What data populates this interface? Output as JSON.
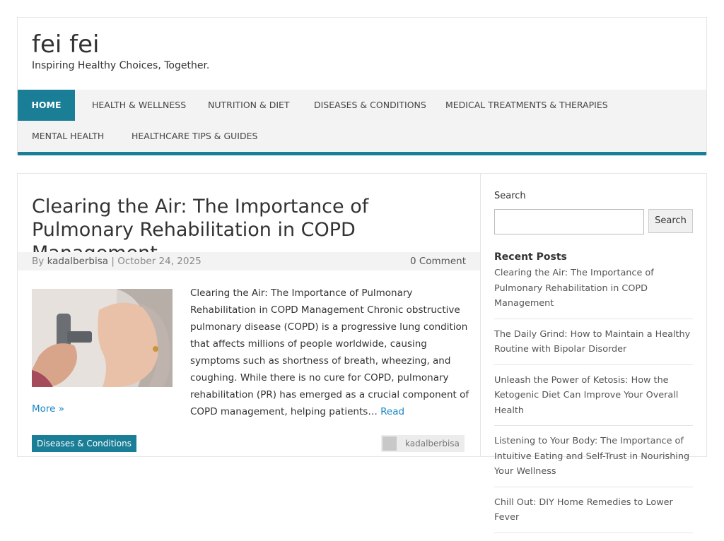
{
  "site": {
    "title": "fei fei",
    "tagline": "Inspiring Healthy Choices, Together."
  },
  "nav": {
    "items": [
      {
        "label": "HOME",
        "active": true
      },
      {
        "label": "HEALTH & WELLNESS"
      },
      {
        "label": "NUTRITION & DIET"
      },
      {
        "label": "DISEASES & CONDITIONS"
      },
      {
        "label": "MEDICAL TREATMENTS & THERAPIES"
      },
      {
        "label": "MENTAL HEALTH"
      },
      {
        "label": "HEALTHCARE TIPS & GUIDES"
      }
    ]
  },
  "post": {
    "title": "Clearing the Air: The Importance of Pulmonary Rehabilitation in COPD Management",
    "by_prefix": "By",
    "author": "kadalberbisa",
    "separator": "|",
    "date": "October 24, 2025",
    "comments": "0 Comment",
    "excerpt": "Clearing the Air: The Importance of Pulmonary Rehabilitation in COPD Management Chronic obstructive pulmonary disease (COPD) is a progressive lung condition that affects millions of people worldwide, causing symptoms such as shortness of breath, wheezing, and coughing. While there is no cure for COPD, pulmonary rehabilitation (PR) has emerged as a crucial component of COPD management, helping patients…",
    "read_more_1": "Read",
    "read_more_2": "More »",
    "category": "Diseases & Conditions",
    "footer_author": "kadalberbisa"
  },
  "sidebar": {
    "search_label": "Search",
    "search_button": "Search",
    "search_value": "",
    "recent_title": "Recent Posts",
    "recent_posts": [
      "Clearing the Air: The Importance of Pulmonary Rehabilitation in COPD Management",
      "The Daily Grind: How to Maintain a Healthy Routine with Bipolar Disorder",
      "Unleash the Power of Ketosis: How the Ketogenic Diet Can Improve Your Overall Health",
      "Listening to Your Body: The Importance of Intuitive Eating and Self-Trust in Nourishing Your Wellness",
      "Chill Out: DIY Home Remedies to Lower Fever"
    ]
  },
  "colors": {
    "accent": "#1a7e96",
    "link": "#1a86c4"
  }
}
